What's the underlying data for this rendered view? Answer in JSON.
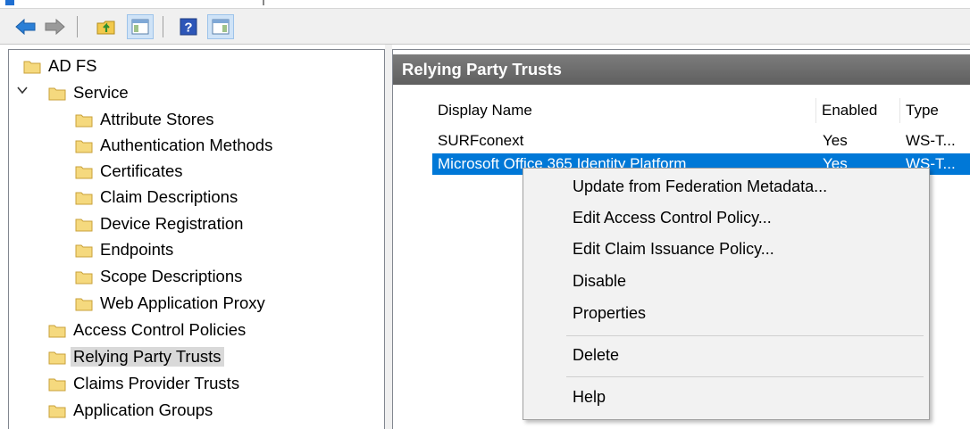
{
  "toolbar": {
    "buttons": [
      "back-arrow-icon",
      "forward-arrow-icon",
      "up-folder-icon",
      "show-hide-console-tree-icon",
      "help-icon",
      "show-hide-action-pane-icon"
    ]
  },
  "tree": {
    "root": "AD FS",
    "service": "Service",
    "service_children": [
      "Attribute Stores",
      "Authentication Methods",
      "Certificates",
      "Claim Descriptions",
      "Device Registration",
      "Endpoints",
      "Scope Descriptions",
      "Web Application Proxy"
    ],
    "access_control_policies": "Access Control Policies",
    "relying_party_trusts": "Relying Party Trusts",
    "claims_provider_trusts": "Claims Provider Trusts",
    "application_groups": "Application Groups",
    "selected": "Relying Party Trusts"
  },
  "content": {
    "header": "Relying Party Trusts",
    "columns": [
      "Display Name",
      "Enabled",
      "Type"
    ],
    "rows": [
      {
        "display_name": "SURFconext",
        "enabled": "Yes",
        "type": "WS-T..."
      },
      {
        "display_name": "Microsoft Office 365 Identity Platform",
        "enabled": "Yes",
        "type": "WS-T..."
      }
    ]
  },
  "context_menu": {
    "items": [
      "Update from Federation Metadata...",
      "Edit Access Control Policy...",
      "Edit Claim Issuance Policy...",
      "Disable",
      "Properties",
      "Delete",
      "Help"
    ]
  },
  "colors": {
    "selection_blue": "#0078d7",
    "header_gray": "#6b6b6b",
    "folder_yellow": "#f5d97e",
    "menu_bg": "#f2f2f2"
  }
}
